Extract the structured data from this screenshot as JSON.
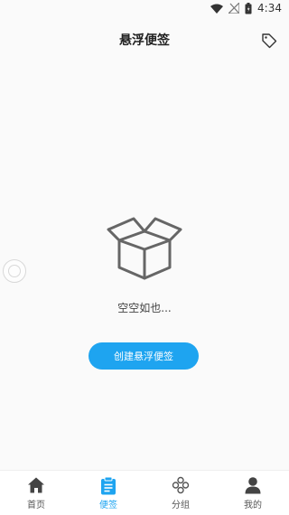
{
  "status_bar": {
    "time": "4:34"
  },
  "header": {
    "title": "悬浮便签"
  },
  "empty_state": {
    "text": "空空如也..."
  },
  "create_button": {
    "label": "创建悬浮便签"
  },
  "bottom_nav": {
    "items": [
      {
        "label": "首页",
        "icon": "home-icon",
        "active": false
      },
      {
        "label": "便签",
        "icon": "note-icon",
        "active": true
      },
      {
        "label": "分组",
        "icon": "group-icon",
        "active": false
      },
      {
        "label": "我的",
        "icon": "profile-icon",
        "active": false
      }
    ]
  },
  "colors": {
    "accent": "#1ea4f0",
    "background": "#fafafa"
  }
}
